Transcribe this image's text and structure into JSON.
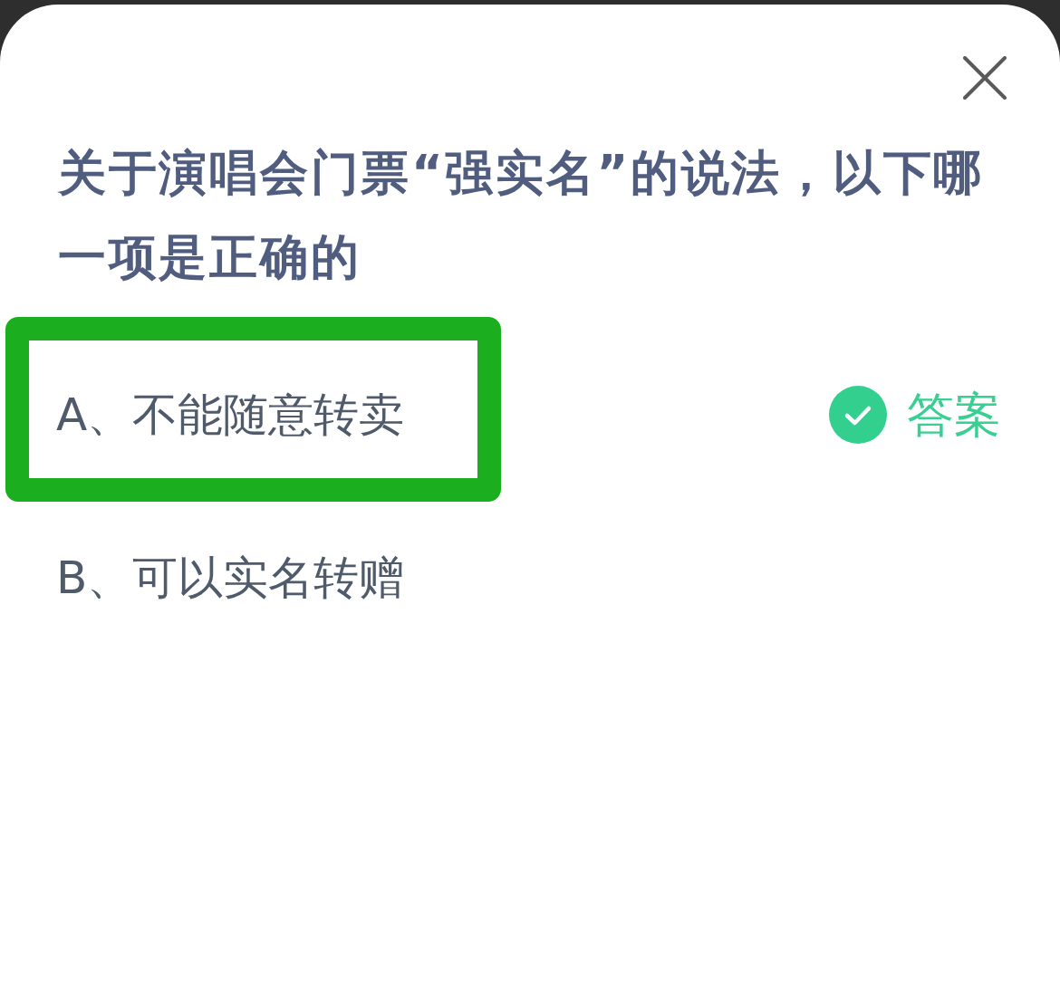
{
  "question": {
    "title": "关于演唱会门票“强实名”的说法，以下哪一项是正确的"
  },
  "answer_label": "答案",
  "options": [
    {
      "label": "A、不能随意转卖",
      "correct": true,
      "highlighted": true
    },
    {
      "label": "B、可以实名转赠",
      "correct": false,
      "highlighted": false
    }
  ]
}
